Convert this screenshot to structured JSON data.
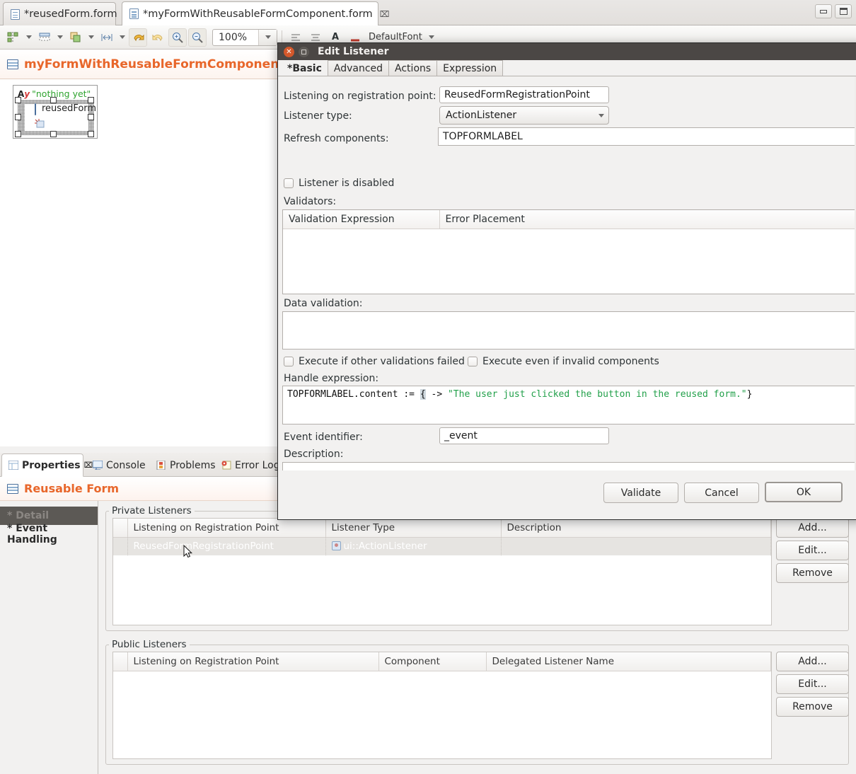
{
  "window": {
    "minimize_label": "minimize",
    "maximize_label": "restore"
  },
  "editor_tabs": [
    {
      "label": "*reusedForm.form",
      "active": false,
      "closable": false
    },
    {
      "label": "*myFormWithReusableFormComponent.form",
      "active": true,
      "closable": true,
      "close_glyph": "⌧"
    }
  ],
  "toolbar": {
    "zoom_value": "100%",
    "font_label": "DefaultFont",
    "items": [
      "align-components-icon",
      "align-dropdown",
      "distribute-icon",
      "distribute-dropdown",
      "layer-icon",
      "layer-dropdown",
      "match-width-icon",
      "match-width-dropdown",
      "undo-icon",
      "redo-icon",
      "zoom-in-icon",
      "zoom-out-icon"
    ]
  },
  "editor": {
    "title": "myFormWithReusableFormComponent",
    "canvas": {
      "label_prefix": "A",
      "label_prefix_suffix": "y",
      "label_text": "\"nothing yet\"",
      "component_name": "reusedForm"
    }
  },
  "view_tabs": [
    {
      "label": "Properties",
      "icon": "properties-icon",
      "active": true,
      "close_glyph": "⌧"
    },
    {
      "label": "Console",
      "icon": "console-icon",
      "active": false
    },
    {
      "label": "Problems",
      "icon": "problems-icon",
      "active": false
    },
    {
      "label": "Error Log",
      "icon": "error-log-icon",
      "active": false
    }
  ],
  "properties": {
    "header_title": "Reusable Form",
    "header_accent": "#e8662a",
    "sections": [
      {
        "label": "* Detail",
        "selected": true
      },
      {
        "label": "* Event Handling",
        "selected": false
      }
    ],
    "private_listeners": {
      "group_label": "Private Listeners",
      "columns": [
        "Listening on Registration Point",
        "Listener Type",
        "Description"
      ],
      "rows": [
        {
          "registration_point": "ReusedFormRegistrationPoint",
          "listener_type": "ui::ActionListener",
          "description": "",
          "selected": true
        }
      ],
      "buttons": [
        "Add...",
        "Edit...",
        "Remove"
      ]
    },
    "public_listeners": {
      "group_label": "Public Listeners",
      "columns": [
        "Listening on Registration Point",
        "Component",
        "Delegated Listener Name"
      ],
      "rows": [],
      "buttons": [
        "Add...",
        "Edit...",
        "Remove"
      ]
    }
  },
  "dialog": {
    "title": "Edit Listener",
    "tabs": [
      {
        "label": "*Basic",
        "active": true
      },
      {
        "label": "Advanced",
        "active": false
      },
      {
        "label": "Actions",
        "active": false
      },
      {
        "label": "Expression",
        "active": false
      }
    ],
    "fields": {
      "registration_point_label": "Listening on registration point:",
      "registration_point_value": "ReusedFormRegistrationPoint",
      "listener_type_label": "Listener type:",
      "listener_type_value": "ActionListener",
      "refresh_components_label": "Refresh components:",
      "refresh_components_value": "TOPFORMLABEL",
      "listener_disabled_label": "Listener is disabled",
      "listener_disabled_checked": false,
      "validators_label": "Validators:",
      "validators_columns": [
        "Validation Expression",
        "Error Placement"
      ],
      "validators_rows": [],
      "data_validation_label": "Data validation:",
      "data_validation_value": "",
      "exec_if_failed_label": "Execute if other validations failed",
      "exec_if_failed_checked": false,
      "exec_invalid_label": "Execute even if invalid components",
      "exec_invalid_checked": false,
      "handle_expression_label": "Handle expression:",
      "handle_expression_code_pre": "TOPFORMLABEL.content := ",
      "handle_expression_code_bracket": "{",
      "handle_expression_code_mid": " -> ",
      "handle_expression_code_str": "\"The user just clicked the button in the reused form.\"",
      "handle_expression_code_post": "}",
      "event_identifier_label": "Event identifier:",
      "event_identifier_value": "_event",
      "description_label": "Description:",
      "description_value": ""
    },
    "buttons": {
      "validate": "Validate",
      "cancel": "Cancel",
      "ok": "OK"
    }
  }
}
